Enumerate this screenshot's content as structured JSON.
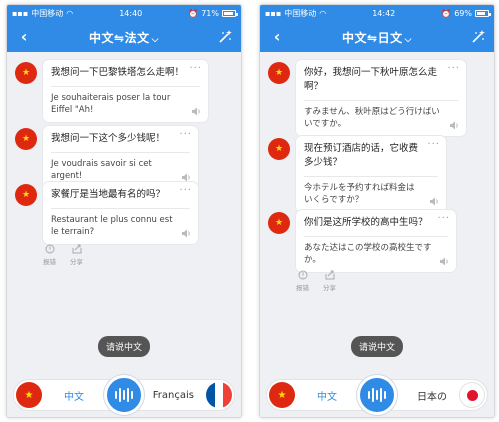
{
  "left": {
    "status": {
      "carrier": "中国移动",
      "time": "14:40",
      "battery": "71%",
      "battery_level": 0.71
    },
    "nav": {
      "title": "中文⇋法文",
      "chevron": "⌵"
    },
    "messages": [
      {
        "source": "我想问一下巴黎铁塔怎么走啊！",
        "translation": "Je souhaiterais poser la tour Eiffel \"Ah!"
      },
      {
        "source": "我想问一下这个多少钱呢！",
        "translation": "Je voudrais savoir si cet argent!"
      },
      {
        "source": "家餐厅是当地最有名的吗？",
        "translation": "Restaurant le plus connu est le terrain?"
      }
    ],
    "actions": {
      "report": "报错",
      "share": "分享"
    },
    "hint": "请说中文",
    "bottom": {
      "left_lang": "中文",
      "right_lang": "Français"
    }
  },
  "right": {
    "status": {
      "carrier": "中国移动",
      "time": "14:42",
      "battery": "69%",
      "battery_level": 0.69
    },
    "nav": {
      "title": "中文⇋日文",
      "chevron": "⌵"
    },
    "messages": [
      {
        "source": "你好，我想问一下秋叶原怎么走啊？",
        "translation": "すみません、秋叶原はどう行けばいいですか。"
      },
      {
        "source": "现在预订酒店的话，它收费多少钱？",
        "translation": "今ホテルを予约すれば料金はいくらですか？"
      },
      {
        "source": "你们是这所学校的高中生吗？",
        "translation": "あなた达はこの学校の高校生ですか。"
      }
    ],
    "actions": {
      "report": "报错",
      "share": "分享"
    },
    "hint": "请说中文",
    "bottom": {
      "left_lang": "中文",
      "right_lang": "日本の"
    }
  },
  "colors": {
    "brand_blue": "#2f8be6",
    "cn_red": "#de2910",
    "cn_yellow": "#ffde00",
    "fr_blue": "#0055a4",
    "fr_red": "#ef4135",
    "jp_red": "#e0142b"
  },
  "icons": [
    "back-chevron-icon",
    "wand-icon",
    "more-dots-icon",
    "speaker-icon",
    "report-icon",
    "share-icon",
    "mic-wave-icon"
  ]
}
